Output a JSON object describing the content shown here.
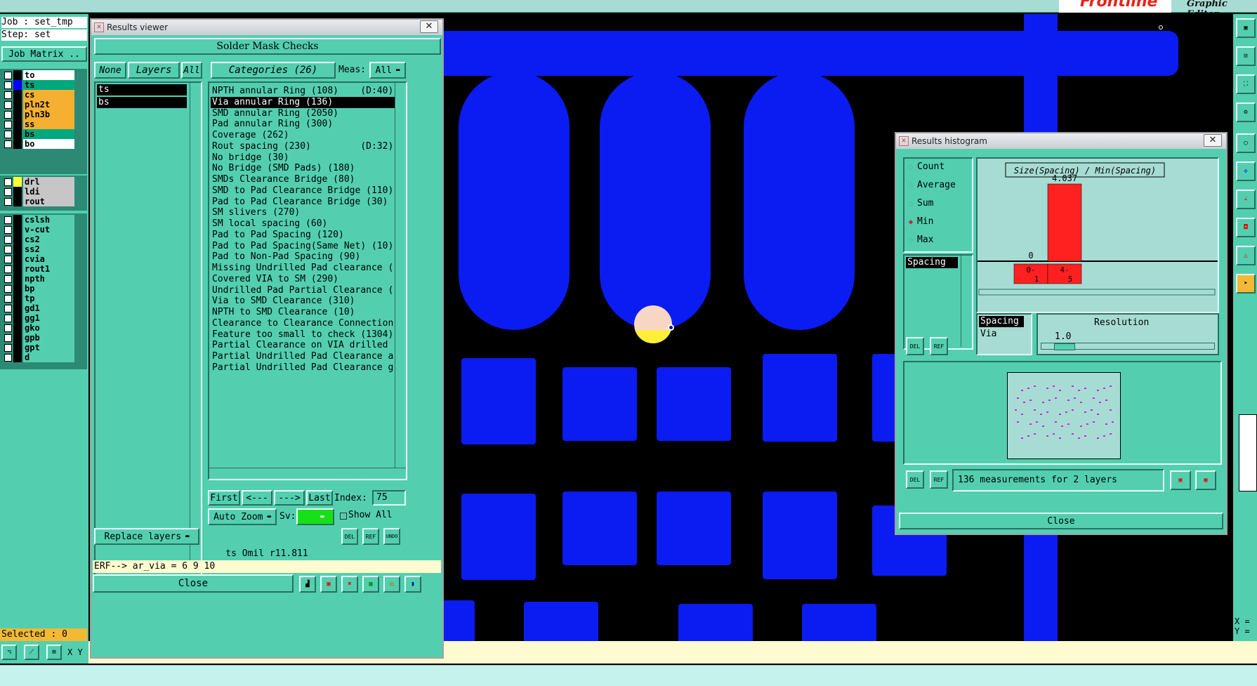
{
  "app": {
    "job_label": "Job : set_tmp",
    "step_label": "Step: set",
    "job_matrix": "Job Matrix ..",
    "graphic_editor": "Graphic Editor",
    "brand": "Frontline",
    "selected": "Selected : 0",
    "xy_label": "X Y",
    "coord_x": "X =",
    "coord_y": "Y ="
  },
  "layers": [
    {
      "name": "to",
      "color": "#ffffff",
      "marker": "#000000"
    },
    {
      "name": "ts",
      "color": "#00a87e",
      "marker": "#0000ff",
      "active": true
    },
    {
      "name": "cs",
      "color": "#f5b031",
      "marker": "#000000"
    },
    {
      "name": "pln2t",
      "color": "#f5b031",
      "marker": "#000000"
    },
    {
      "name": "pln3b",
      "color": "#f5b031",
      "marker": "#000000"
    },
    {
      "name": "ss",
      "color": "#f5b031",
      "marker": "#000000"
    },
    {
      "name": "bs",
      "color": "#00a87e",
      "marker": "#000000"
    },
    {
      "name": "bo",
      "color": "#ffffff",
      "marker": "#000000"
    }
  ],
  "layers2": [
    {
      "name": "drl",
      "color": "#c6c6c6",
      "marker": "#ffff33"
    },
    {
      "name": "ldi",
      "color": "#c6c6c6",
      "marker": "#000000"
    },
    {
      "name": "rout",
      "color": "#c6c6c6",
      "marker": "#000000"
    }
  ],
  "layers3": [
    "cslsh",
    "v-cut",
    "cs2",
    "ss2",
    "cvia",
    "rout1",
    "npth",
    "bp",
    "tp",
    "gd1",
    "gg1",
    "gko",
    "gpb",
    "gpt",
    "d"
  ],
  "results_viewer": {
    "window_title": "Results viewer",
    "header": "Solder Mask Checks",
    "none_btn": "None",
    "layers_btn": "Layers",
    "all_btn": "All",
    "categories_btn": "Categories (26)",
    "meas_label": "Meas:",
    "meas_value": "All",
    "selected_layers": [
      "ts",
      "bs"
    ],
    "categories": [
      "NPTH annular Ring (108)    (D:40)",
      "Via annular Ring (136)",
      "SMD annular Ring (2050)",
      "Pad annular Ring (300)",
      "Coverage (262)",
      "Rout spacing (230)         (D:32)",
      "No bridge (30)",
      "No Bridge (SMD Pads) (180)",
      "SMDs Clearance Bridge (80)",
      "SMD to Pad Clearance Bridge (110)",
      "Pad to Pad Clearance Bridge (30)",
      "SM slivers (270)",
      "SM local spacing (60)",
      "Pad to Pad Spacing (120)",
      "Pad to Pad Spacing(Same Net) (10)",
      "Pad to Non-Pad Spacing (90)",
      "Missing Undrilled Pad clearance (",
      "Covered VIA to SM (290)",
      "Undrilled Pad Partial Clearance (",
      "Via to SMD Clearance (310)",
      "NPTH to SMD Clearance (10)",
      "Clearance to Clearance Connection",
      "Feature too small to check (1304)",
      "Partial Clearance on VIA drilled",
      "Partial Undrilled Pad Clearance a",
      "Partial Undrilled Pad Clearance g"
    ],
    "selected_category_index": 1,
    "first_btn": "First",
    "prev_btn": "<---",
    "next_btn": "--->",
    "last_btn": "Last",
    "index_label": "Index:",
    "index_value": "75",
    "auto_zoom": "Auto Zoom",
    "sv_label": "Sv:",
    "show_all": "Show All",
    "replace_layers": "Replace layers",
    "status_line": "ts Omil  r11.811",
    "erf_line": "ERF--> ar_via = 6 9 10",
    "close_btn": "Close",
    "del": "DEL",
    "ref": "REF",
    "undo": "UNDO"
  },
  "histogram": {
    "window_title": "Results histogram",
    "options": [
      "Count",
      "Average",
      "Sum",
      "Min",
      "Max"
    ],
    "selected_option": "Min",
    "measure_list": [
      "Spacing"
    ],
    "title": "Size(Spacing) / Min(Spacing)",
    "bin_labels": [
      "0-\n1",
      "4-\n5"
    ],
    "measure_list2": [
      "Spacing",
      "Via"
    ],
    "resolution_label": "Resolution",
    "resolution_value": "1.0",
    "summary": "136 measurements for 2 layers",
    "close_btn": "Close",
    "del": "DEL",
    "ref": "REF"
  },
  "chart_data": {
    "type": "bar",
    "title": "Size(Spacing) / Min(Spacing)",
    "categories": [
      "0-1",
      "4-5"
    ],
    "values": [
      0,
      4.037
    ],
    "value_labels": [
      "0",
      "4.037"
    ]
  }
}
